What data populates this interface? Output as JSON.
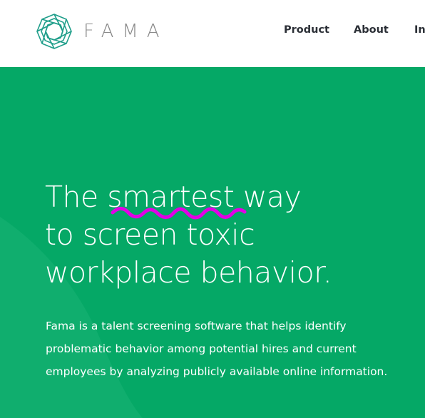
{
  "header": {
    "logo": {
      "icon": "fama-geometric-logo-icon",
      "wordmark": "FAMA"
    },
    "nav": [
      {
        "label": "Product"
      },
      {
        "label": "About"
      },
      {
        "label": "In"
      }
    ]
  },
  "hero": {
    "headline": {
      "line1": "The smartest way",
      "line2": "to screen toxic",
      "line3": "workplace behavior."
    },
    "description": "Fama is a talent screening software that helps identify problematic behavior among potential hires and current employees by analyzing publicly available online information.",
    "annotation": {
      "type": "squiggle-underline",
      "target_word": "smartest",
      "color": "#e100e6"
    }
  },
  "colors": {
    "brand_green": "#05a866",
    "logo_teal": "#1f9e8a",
    "nav_text": "#2b2f36",
    "wordmark_gray": "#8a8a8a",
    "annotation_magenta": "#e100e6"
  }
}
